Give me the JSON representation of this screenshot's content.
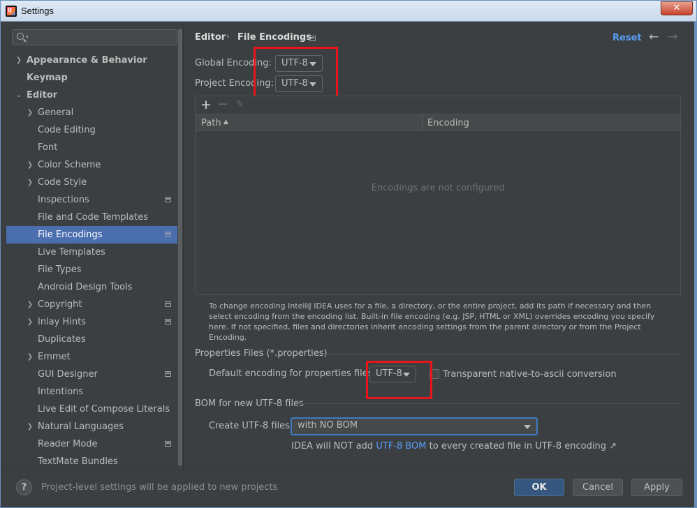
{
  "window": {
    "title": "Settings",
    "close_label": "✕"
  },
  "search": {
    "placeholder": ""
  },
  "sidebar": {
    "items": [
      {
        "label": "Appearance & Behavior"
      },
      {
        "label": "Keymap"
      },
      {
        "label": "Editor"
      },
      {
        "label": "General"
      },
      {
        "label": "Code Editing"
      },
      {
        "label": "Font"
      },
      {
        "label": "Color Scheme"
      },
      {
        "label": "Code Style"
      },
      {
        "label": "Inspections"
      },
      {
        "label": "File and Code Templates"
      },
      {
        "label": "File Encodings"
      },
      {
        "label": "Live Templates"
      },
      {
        "label": "File Types"
      },
      {
        "label": "Android Design Tools"
      },
      {
        "label": "Copyright"
      },
      {
        "label": "Inlay Hints"
      },
      {
        "label": "Duplicates"
      },
      {
        "label": "Emmet"
      },
      {
        "label": "GUI Designer"
      },
      {
        "label": "Intentions"
      },
      {
        "label": "Live Edit of Compose Literals"
      },
      {
        "label": "Natural Languages"
      },
      {
        "label": "Reader Mode"
      },
      {
        "label": "TextMate Bundles"
      }
    ]
  },
  "header": {
    "crumb_parent": "Editor",
    "crumb_sep": "›",
    "crumb_current": "File Encodings",
    "reset": "Reset",
    "back": "←",
    "forward": "→"
  },
  "encodings": {
    "global_label": "Global Encoding:",
    "global_value": "UTF-8",
    "project_label": "Project Encoding:",
    "project_value": "UTF-8"
  },
  "table": {
    "add": "+",
    "remove": "−",
    "edit": "✎",
    "col_path": "Path",
    "sort_indicator": "▲",
    "col_encoding": "Encoding",
    "empty": "Encodings are not configured"
  },
  "help_text": "To change encoding IntelliJ IDEA uses for a file, a directory, or the entire project, add its path if necessary and then select encoding from the encoding list. Built-in file encoding (e.g. JSP, HTML or XML) overrides encoding you specify here. If not specified, files and directories inherit encoding settings from the parent directory or from the Project Encoding.",
  "properties": {
    "section": "Properties Files (*.properties)",
    "default_label": "Default encoding for properties files:",
    "default_value": "UTF-8",
    "transparent_label": "Transparent native-to-ascii conversion",
    "transparent_checked": false
  },
  "bom": {
    "section": "BOM for new UTF-8 files",
    "create_label": "Create UTF-8 files:",
    "create_value": "with NO BOM",
    "note_prefix": "IDEA will NOT add ",
    "note_link": "UTF-8 BOM",
    "note_suffix": " to every created file in UTF-8 encoding ↗"
  },
  "footer": {
    "help": "?",
    "status": "Project-level settings will be applied to new projects",
    "ok": "OK",
    "cancel": "Cancel",
    "apply": "Apply"
  },
  "colors": {
    "background": "#3c3f41",
    "selection": "#4b6eaf",
    "link": "#589df6",
    "primary_button": "#365880",
    "highlight_box": "#e8151a"
  }
}
